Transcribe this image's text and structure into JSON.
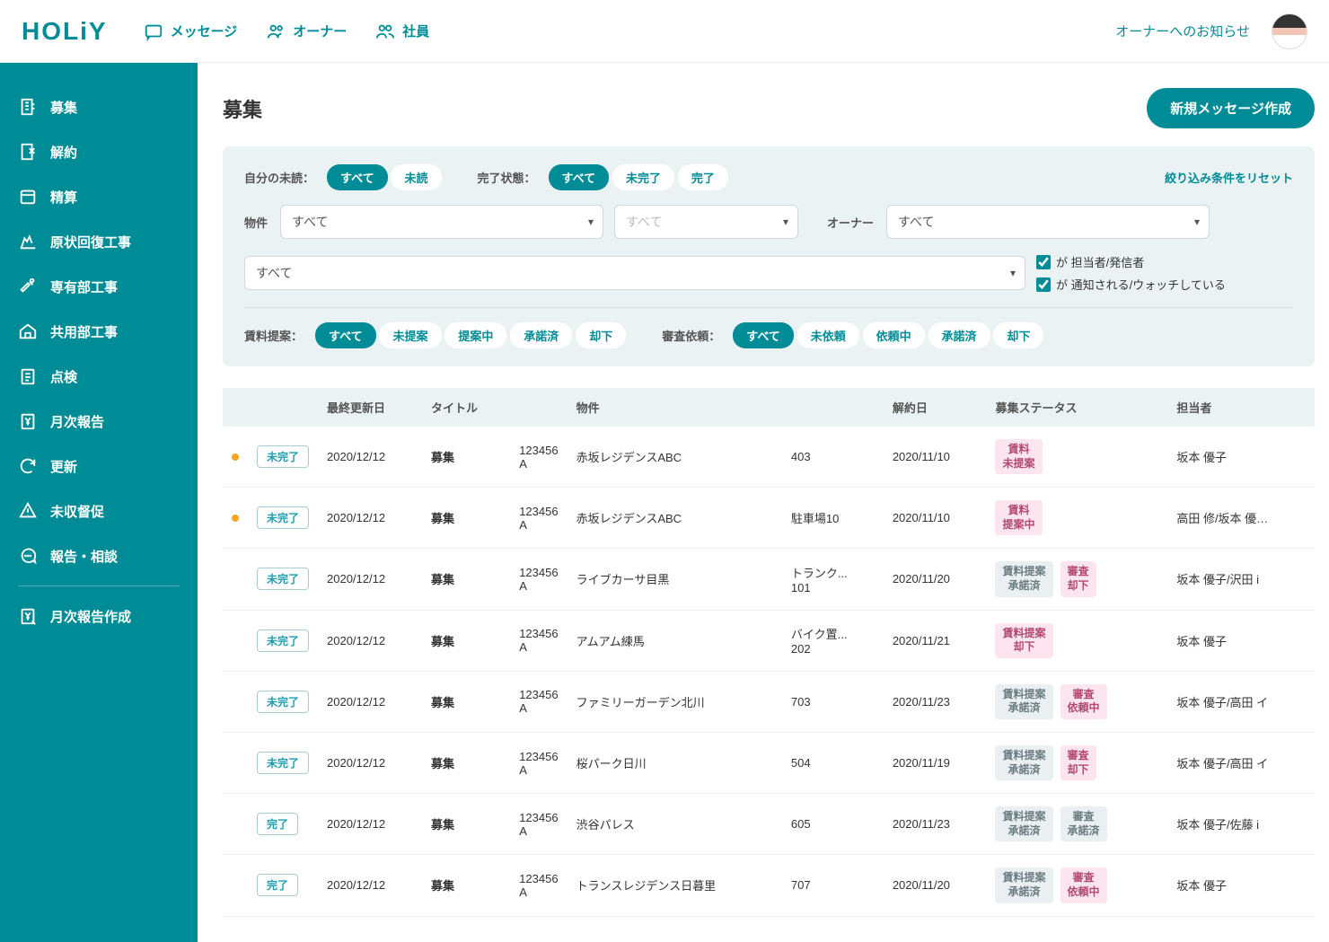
{
  "brand": "HOLiY",
  "topnav": [
    {
      "label": "メッセージ",
      "icon": "message"
    },
    {
      "label": "オーナー",
      "icon": "owner"
    },
    {
      "label": "社員",
      "icon": "staff"
    }
  ],
  "top_link": "オーナーへのお知らせ",
  "sidebar": [
    {
      "label": "募集",
      "icon": "recruit"
    },
    {
      "label": "解約",
      "icon": "cancel"
    },
    {
      "label": "精算",
      "icon": "settle"
    },
    {
      "label": "原状回復工事",
      "icon": "restore"
    },
    {
      "label": "専有部工事",
      "icon": "exclusive"
    },
    {
      "label": "共用部工事",
      "icon": "shared"
    },
    {
      "label": "点検",
      "icon": "inspect"
    },
    {
      "label": "月次報告",
      "icon": "monthly"
    },
    {
      "label": "更新",
      "icon": "update"
    },
    {
      "label": "未収督促",
      "icon": "dunning"
    },
    {
      "label": "報告・相談",
      "icon": "consult"
    },
    {
      "label": "月次報告作成",
      "icon": "monthly-create",
      "after_divider": true
    }
  ],
  "page_title": "募集",
  "primary_button": "新規メッセージ作成",
  "filters": {
    "unread_label": "自分の未読：",
    "unread_options": [
      {
        "label": "すべて",
        "active": true
      },
      {
        "label": "未読",
        "active": false
      }
    ],
    "complete_label": "完了状態：",
    "complete_options": [
      {
        "label": "すべて",
        "active": true
      },
      {
        "label": "未完了",
        "active": false
      },
      {
        "label": "完了",
        "active": false
      }
    ],
    "reset": "絞り込み条件をリセット",
    "property_label": "物件",
    "property_value": "すべて",
    "property_sub_value": "すべて",
    "owner_label": "オーナー",
    "owner_value": "すべて",
    "person_value": "すべて",
    "checkbox1": "が 担当者/発信者",
    "checkbox2": "が 通知される/ウォッチしている",
    "rent_label": "賃料提案：",
    "rent_options": [
      {
        "label": "すべて",
        "active": true
      },
      {
        "label": "未提案",
        "active": false
      },
      {
        "label": "提案中",
        "active": false
      },
      {
        "label": "承諾済",
        "active": false
      },
      {
        "label": "却下",
        "active": false
      }
    ],
    "review_label": "審査依頼：",
    "review_options": [
      {
        "label": "すべて",
        "active": true
      },
      {
        "label": "未依頼",
        "active": false
      },
      {
        "label": "依頼中",
        "active": false
      },
      {
        "label": "承諾済",
        "active": false
      },
      {
        "label": "却下",
        "active": false
      }
    ]
  },
  "columns": [
    "",
    "",
    "最終更新日",
    "タイトル",
    "",
    "物件",
    "",
    "解約日",
    "募集ステータス",
    "担当者"
  ],
  "rows": [
    {
      "dot": true,
      "status": "未完了",
      "date": "2020/12/12",
      "title": "募集",
      "code": "123456A",
      "property": "赤坂レジデンスABC",
      "unit": "403",
      "cancel_date": "2020/11/10",
      "tags": [
        {
          "t": "賃料\n未提案",
          "c": "pink"
        }
      ],
      "person": "坂本 優子"
    },
    {
      "dot": true,
      "status": "未完了",
      "date": "2020/12/12",
      "title": "募集",
      "code": "123456A",
      "property": "赤坂レジデンスABC",
      "unit": "駐車場10",
      "cancel_date": "2020/11/10",
      "tags": [
        {
          "t": "賃料\n提案中",
          "c": "pink"
        }
      ],
      "person": "高田 修/坂本 優…"
    },
    {
      "dot": false,
      "status": "未完了",
      "date": "2020/12/12",
      "title": "募集",
      "code": "123456A",
      "property": "ライブカーサ目黒",
      "unit": "トランク...101",
      "cancel_date": "2020/11/20",
      "tags": [
        {
          "t": "賃料提案\n承諾済",
          "c": "gray"
        },
        {
          "t": "審査\n却下",
          "c": "pink"
        }
      ],
      "person": "坂本 優子/沢田 i"
    },
    {
      "dot": false,
      "status": "未完了",
      "date": "2020/12/12",
      "title": "募集",
      "code": "123456A",
      "property": "アムアム練馬",
      "unit": "バイク置...202",
      "cancel_date": "2020/11/21",
      "tags": [
        {
          "t": "賃料提案\n却下",
          "c": "pink"
        }
      ],
      "person": "坂本 優子"
    },
    {
      "dot": false,
      "status": "未完了",
      "date": "2020/12/12",
      "title": "募集",
      "code": "123456A",
      "property": "ファミリーガーデン北川",
      "unit": "703",
      "cancel_date": "2020/11/23",
      "tags": [
        {
          "t": "賃料提案\n承諾済",
          "c": "gray"
        },
        {
          "t": "審査\n依頼中",
          "c": "pink"
        }
      ],
      "person": "坂本 優子/高田 イ"
    },
    {
      "dot": false,
      "status": "未完了",
      "date": "2020/12/12",
      "title": "募集",
      "code": "123456A",
      "property": "桜パーク日川",
      "unit": "504",
      "cancel_date": "2020/11/19",
      "tags": [
        {
          "t": "賃料提案\n承諾済",
          "c": "gray"
        },
        {
          "t": "審査\n却下",
          "c": "pink"
        }
      ],
      "person": "坂本 優子/高田 イ"
    },
    {
      "dot": false,
      "status": "完了",
      "date": "2020/12/12",
      "title": "募集",
      "code": "123456A",
      "property": "渋谷パレス",
      "unit": "605",
      "cancel_date": "2020/11/23",
      "tags": [
        {
          "t": "賃料提案\n承諾済",
          "c": "gray"
        },
        {
          "t": "審査\n承諾済",
          "c": "gray"
        }
      ],
      "person": "坂本 優子/佐藤 i"
    },
    {
      "dot": false,
      "status": "完了",
      "date": "2020/12/12",
      "title": "募集",
      "code": "123456A",
      "property": "トランスレジデンス日暮里",
      "unit": "707",
      "cancel_date": "2020/11/20",
      "tags": [
        {
          "t": "賃料提案\n承諾済",
          "c": "gray"
        },
        {
          "t": "審査\n依頼中",
          "c": "pink"
        }
      ],
      "person": "坂本 優子"
    }
  ]
}
